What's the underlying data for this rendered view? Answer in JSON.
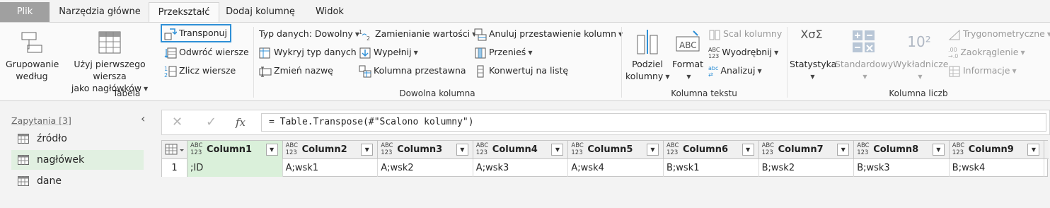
{
  "tabs": [
    "Plik",
    "Narzędzia główne",
    "Przekształć",
    "Dodaj kolumnę",
    "Widok"
  ],
  "ribbon": {
    "tabela": {
      "group_label": "Tabela",
      "grupowanie": [
        "Grupowanie",
        "według"
      ],
      "uzyj": [
        "Użyj pierwszego wiersza",
        "jako nagłówków"
      ],
      "transponuj": "Transponuj",
      "odwroc": "Odwróć wiersze",
      "zlicz": "Zlicz wiersze"
    },
    "dowolna": {
      "group_label": "Dowolna kolumna",
      "typ_danych": "Typ danych: Dowolny",
      "wykryj": "Wykryj typ danych",
      "zmien_nazwe": "Zmień nazwę",
      "zamienianie": "Zamienianie wartości",
      "wypelnij": "Wypełnij",
      "kolumna_przestawna": "Kolumna przestawna",
      "anuluj": "Anuluj przestawienie kolumn",
      "przenies": "Przenieś",
      "konwertuj": "Konwertuj na listę"
    },
    "tekst": {
      "group_label": "Kolumna tekstu",
      "podziel": [
        "Podziel",
        "kolumny"
      ],
      "format": "Format",
      "scal": "Scal kolumny",
      "wyodrebnij": "Wyodrębnij",
      "analizuj": "Analizuj",
      "abc_label": "ABC"
    },
    "liczb": {
      "group_label": "Kolumna liczb",
      "statystyka": "Statystyka",
      "standardowy": "Standardowy",
      "wykladnicze": "Wykładnicze",
      "trygonometryczne": "Trygonometryczne",
      "zaokraglenie": "Zaokrąglenie",
      "informacje": "Informacje",
      "sigma_top": "XσΣ",
      "power_label": "10²"
    }
  },
  "queries": {
    "header": "Zapytania [3]",
    "items": [
      "źródło",
      "nagłówek",
      "dane"
    ]
  },
  "formula": {
    "fx": "fx",
    "text": "= Table.Transpose(#\"Scalono kolumny\")"
  },
  "table": {
    "type_label_top": "ABC",
    "type_label_bottom": "123",
    "columns": [
      "Column1",
      "Column2",
      "Column3",
      "Column4",
      "Column5",
      "Column6",
      "Column7",
      "Column8",
      "Column9"
    ],
    "rows": [
      {
        "num": "1",
        "cells": [
          ";ID",
          "A;wsk1",
          "A;wsk2",
          "A;wsk3",
          "A;wsk4",
          "B;wsk1",
          "B;wsk2",
          "B;wsk3",
          "B;wsk4"
        ]
      }
    ]
  },
  "colors": {
    "accent": "#2e8fd6",
    "selected_green": "#daf0da",
    "file_tab": "#a0a0a0"
  }
}
